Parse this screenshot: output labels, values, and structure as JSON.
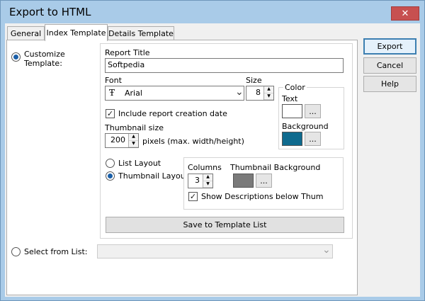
{
  "window": {
    "title": "Export to HTML",
    "close_glyph": "✕"
  },
  "tabs": [
    {
      "label": "General"
    },
    {
      "label": "Index Template"
    },
    {
      "label": "Details Template"
    }
  ],
  "buttons": {
    "export": "Export",
    "cancel": "Cancel",
    "help": "Help"
  },
  "options": {
    "customize": "Customize\nTemplate:",
    "select_from_list": "Select from List:",
    "select_value": ""
  },
  "template": {
    "report_title_label": "Report Title",
    "report_title_value": "Softpedia",
    "font_label": "Font",
    "font_value": "Arial",
    "font_icon_glyph": "Ŧ",
    "size_label": "Size",
    "size_value": "8",
    "color_group": "Color",
    "text_color_label": "Text",
    "background_color_label": "Background",
    "swatch_button": "...",
    "include_date_label": "Include report creation date",
    "thumbnail_size_label": "Thumbnail size",
    "thumbnail_size_value": "200",
    "pixels_label": "pixels (max. width/height)",
    "list_layout": "List Layout",
    "thumbnail_layout": "Thumbnail Layout",
    "columns_label": "Columns",
    "columns_value": "3",
    "thumb_bg_label": "Thumbnail Background",
    "show_desc_label": "Show Descriptions below Thum",
    "save_button": "Save to Template List",
    "check_glyph": "✓",
    "up_glyph": "▲",
    "down_glyph": "▼",
    "chevron_glyph": "⌄"
  },
  "colors": {
    "text_color": "#ffffff",
    "background_color": "#0e6a8e",
    "thumb_bg_color": "#7a7a7a",
    "accent": "#1a5fa8"
  }
}
